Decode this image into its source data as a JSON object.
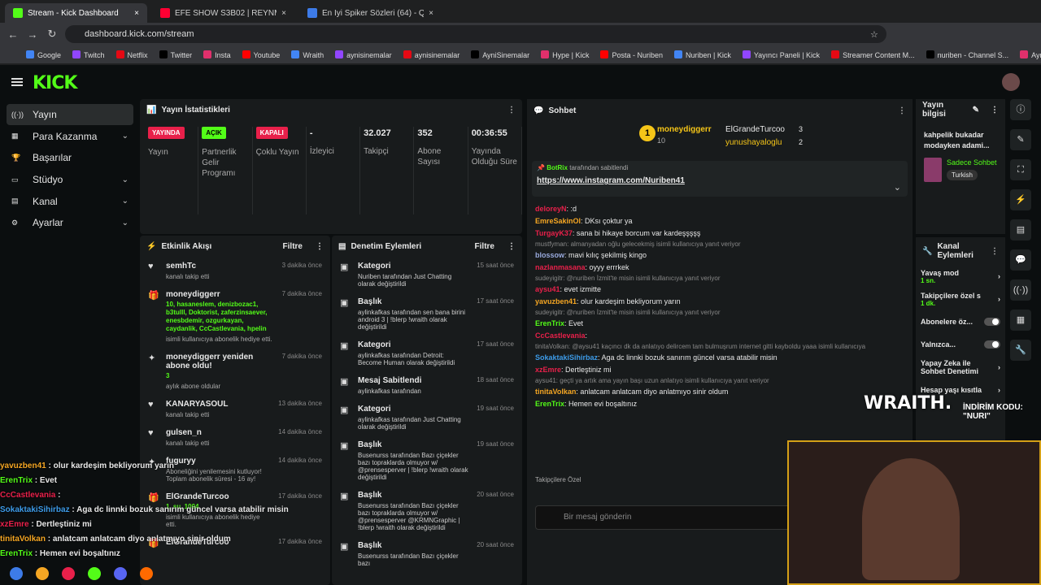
{
  "tabs": [
    {
      "label": "Stream - Kick Dashboard",
      "color": "#53fc18"
    },
    {
      "label": "EFE SHOW S3B02 | REYNMEN -",
      "color": "#ff0033"
    },
    {
      "label": "En İyi Spiker Sözleri (64) - Quiz",
      "color": "#3d7be8"
    }
  ],
  "url": "dashboard.kick.com/stream",
  "bookmarks": [
    "Google",
    "Twitch",
    "Netflix",
    "Twitter",
    "Insta",
    "Youtube",
    "Wraith",
    "aynisinemalar",
    "aynisinemalar",
    "AyniSinemalar",
    "Hype | Kick",
    "Posta - Nuriben",
    "Nuriben | Kick",
    "Yayıncı Paneli | Kick",
    "Streamer Content M...",
    "nuriben - Channel S...",
    "Aynı Sinemalar - Ça..."
  ],
  "logo": "KICK",
  "sidebar": [
    {
      "label": "Yayın",
      "icon": "broadcast-icon",
      "chev": ""
    },
    {
      "label": "Para Kazanma",
      "icon": "money-icon",
      "chev": "⌄"
    },
    {
      "label": "Başarılar",
      "icon": "trophy-icon",
      "chev": ""
    },
    {
      "label": "Stüdyo",
      "icon": "studio-icon",
      "chev": "⌄"
    },
    {
      "label": "Kanal",
      "icon": "channel-icon",
      "chev": "⌄"
    },
    {
      "label": "Ayarlar",
      "icon": "settings-icon",
      "chev": "⌄"
    }
  ],
  "stats": {
    "title": "Yayın İstatistikleri",
    "cols": [
      {
        "badge": "YAYINDA",
        "bcolor": "#e8204a",
        "label": "Yayın"
      },
      {
        "badge": "AÇIK",
        "bcolor": "#53fc18",
        "label": "Partnerlik Gelir Programı"
      },
      {
        "badge": "KAPALI",
        "bcolor": "#e8204a",
        "label": "Çoklu Yayın"
      },
      {
        "value": "-",
        "label": "İzleyici"
      },
      {
        "value": "32.027",
        "label": "Takipçi"
      },
      {
        "value": "352",
        "label": "Abone Sayısı"
      },
      {
        "value": "00:36:55",
        "label": "Yayında Olduğu Süre"
      }
    ]
  },
  "activity": {
    "title": "Etkinlik Akışı",
    "filter": "Filtre",
    "items": [
      {
        "name": "semhTc",
        "sub": "kanalı takip etti",
        "time": "3 dakika önce",
        "green": ""
      },
      {
        "name": "moneydiggerr",
        "sub": "isimli kullanıcıya abonelik hediye etti.",
        "time": "7 dakika önce",
        "green": "10, hasaneslem, denizbozac1, b3tulll, Doktorist, zaferzinsaever, enesbdemir, ozgurkayan, caydanlik, CcCastlevania, hpelin"
      },
      {
        "name": "moneydiggerr yeniden abone oldu!",
        "sub": "aylık abone oldular",
        "time": "7 dakika önce",
        "green": "3"
      },
      {
        "name": "KANARYASOUL",
        "sub": "kanalı takip etti",
        "time": "13 dakika önce",
        "green": ""
      },
      {
        "name": "gulsen_n",
        "sub": "kanalı takip etti",
        "time": "14 dakika önce",
        "green": ""
      },
      {
        "name": "fuguryy",
        "sub": "Aboneliğini yenilemesini kutluyor! Toplam abonelik süresi - 16 ay!",
        "time": "14 dakika önce",
        "green": ""
      },
      {
        "name": "ElGrandeTurcoo",
        "sub": "isimli kullanıcıya abonelik hediye etti.",
        "time": "17 dakika önce",
        "green": "1, su_1004"
      },
      {
        "name": "ElGrandeTurcoo",
        "sub": "",
        "time": "17 dakika önce",
        "green": ""
      }
    ]
  },
  "moderation": {
    "title": "Denetim Eylemleri",
    "filter": "Filtre",
    "items": [
      {
        "title": "Kategori",
        "time": "15 saat önce",
        "text": "Nuriben tarafından Just Chatting olarak değiştirildi"
      },
      {
        "title": "Başlık",
        "time": "17 saat önce",
        "text": "aylinkafkas tarafından sen bana birini android 3 | !blerp !wraith olarak değiştirildi"
      },
      {
        "title": "Kategori",
        "time": "17 saat önce",
        "text": "aylinkafkas tarafından Detroit: Become Human olarak değiştirildi"
      },
      {
        "title": "Mesaj Sabitlendi",
        "time": "18 saat önce",
        "text": "aylinkafkas tarafından"
      },
      {
        "title": "Kategori",
        "time": "19 saat önce",
        "text": "aylinkafkas tarafından Just Chatting olarak değiştirildi"
      },
      {
        "title": "Başlık",
        "time": "19 saat önce",
        "text": "Busenurss tarafından Bazı çiçekler bazı topraklarda olmuyor w/ @prensesperver | !blerp !wraith olarak değiştirildi"
      },
      {
        "title": "Başlık",
        "time": "20 saat önce",
        "text": "Busenurss tarafından Bazı çiçekler bazı topraklarda olmuyor w/ @prensesperver @KRMNGraphic | !blerp !wraith olarak değiştirildi"
      },
      {
        "title": "Başlık",
        "time": "20 saat önce",
        "text": "Busenurss tarafından Bazı çiçekler bazı"
      }
    ]
  },
  "chat": {
    "title": "Sohbet",
    "top": {
      "first": "moneydiggerr",
      "first_count": "10",
      "second": "ElGrandeTurcoo",
      "second_count": "3",
      "third": "yunushayaloglu",
      "third_count": "2"
    },
    "pinned_by": "BotRix",
    "pinned_suffix": "tarafından sabitlendi",
    "pinned_link": "https://www.instagram.com/Nuriben41",
    "messages": [
      {
        "t": "msg",
        "u": "deloreyN",
        "c": "#e8204a",
        "m": ": :d"
      },
      {
        "t": "msg",
        "u": "EmreSakinOl",
        "c": "#f5a623",
        "m": ": DKsı çoktur ya"
      },
      {
        "t": "msg",
        "u": "TurgayK37",
        "c": "#e8204a",
        "m": ": sana bi hikaye borcum var kardeşşşşş"
      },
      {
        "t": "reply",
        "m": "mustfyman: almanyadan oğlu gelecekmiş isimli kullanıcıya yanıt veriyor"
      },
      {
        "t": "msg",
        "u": "blossow",
        "c": "#9ad",
        "m": ": mavi kılıç şekilmiş kingo"
      },
      {
        "t": "msg",
        "u": "nazlanmasana",
        "c": "#e8204a",
        "m": ": oyyy errrkek"
      },
      {
        "t": "reply",
        "m": "sudeyigitr: @nuriben İzmit'te misin isimli kullanıcıya yanıt veriyor"
      },
      {
        "t": "msg",
        "u": "aysu41",
        "c": "#e8204a",
        "m": ": evet izmitte"
      },
      {
        "t": "msg",
        "u": "yavuzben41",
        "c": "#f5a623",
        "m": ": olur kardeşim bekliyorum yarın"
      },
      {
        "t": "reply",
        "m": "sudeyigitr: @nuriben İzmit'te misin isimli kullanıcıya yanıt veriyor"
      },
      {
        "t": "msg",
        "u": "ErenTrix",
        "c": "#53fc18",
        "m": ": Evet"
      },
      {
        "t": "msg",
        "u": "CcCastlevania",
        "c": "#e8204a",
        "m": ":"
      },
      {
        "t": "reply",
        "m": "tinitaVolkan: @aysu41 kaçıncı dk da anlatıyo delircem tam bulmuşrum internet gitti kayboldu yaaa isimli kullanıcıya"
      },
      {
        "t": "msg",
        "u": "SokaktakiSihirbaz",
        "c": "#3d9be8",
        "m": ": Aga dc linnki bozuk sanırım güncel varsa atabilir misin"
      },
      {
        "t": "msg",
        "u": "xzEmre",
        "c": "#e8204a",
        "m": ": Dertleştiniz mi"
      },
      {
        "t": "reply",
        "m": "aysu41: geçti ya artık ama yayın başı uzun anlatıyo isimli kullanıcıya yanıt veriyor"
      },
      {
        "t": "msg",
        "u": "tinitaVolkan",
        "c": "#f5a623",
        "m": ": anlatcam anlatcam diyo anlatmıyo sinir oldum"
      },
      {
        "t": "msg",
        "u": "ErenTrix",
        "c": "#53fc18",
        "m": ": Hemen evi boşaltınız"
      }
    ],
    "followers_only": "Takipçilere Özel",
    "input_placeholder": "Bir mesaj gönderin"
  },
  "streaminfo": {
    "title": "Yayın bilgisi",
    "stream_title": "kahpelik bukadar modayken adami...",
    "mode": "Sadece Sohbet",
    "lang": "Turkish"
  },
  "channel_actions": {
    "title": "Kanal Eylemleri",
    "rows": [
      {
        "label": "Yavaş mod",
        "sub": "1 sn."
      },
      {
        "label": "Takipçilere özel s",
        "sub": "1 dk."
      },
      {
        "label": "Abonelere öz...",
        "sub": ""
      },
      {
        "label": "Yalnızca...",
        "sub": ""
      },
      {
        "label": "Yapay Zeka ile Sohbet Denetimi",
        "sub": ""
      },
      {
        "label": "Hesap yaşı kısıtla",
        "sub": ""
      }
    ]
  },
  "overlay": {
    "brand": "WRAITH.",
    "promo": "İNDİRİM KODU: \"NURI\"",
    "lines": [
      {
        "u": "yavuzben41",
        "c": "#f5a623",
        "m": " : olur kardeşim bekliyorum yarın"
      },
      {
        "u": "ErenTrix",
        "c": "#53fc18",
        "m": " : Evet"
      },
      {
        "u": "CcCastlevania",
        "c": "#e8204a",
        "m": " :"
      },
      {
        "u": "SokaktakiSihirbaz",
        "c": "#3d9be8",
        "m": " : Aga dc linnki bozuk sanırım güncel varsa atabilir misin"
      },
      {
        "u": "xzEmre",
        "c": "#e8204a",
        "m": " : Dertleştiniz mi"
      },
      {
        "u": "tinitaVolkan",
        "c": "#f5a623",
        "m": " : anlatcam anlatcam diyo anlatmıyo sinir oldum"
      },
      {
        "u": "ErenTrix",
        "c": "#53fc18",
        "m": " : Hemen evi boşaltınız"
      }
    ]
  }
}
